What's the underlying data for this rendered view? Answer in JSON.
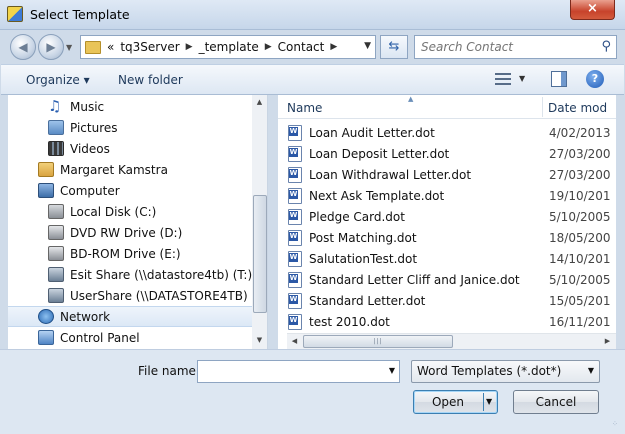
{
  "window": {
    "title": "Select Template",
    "close_label": "×"
  },
  "nav": {
    "back_glyph": "◀",
    "forward_glyph": "▶",
    "refresh_glyph": "⇆"
  },
  "address": {
    "overflow": "«",
    "segments": [
      "tq3Server",
      "_template",
      "Contact"
    ]
  },
  "search": {
    "placeholder": "Search Contact"
  },
  "toolbar": {
    "organize_label": "Organize ▾",
    "new_folder_label": "New folder",
    "help_label": "?"
  },
  "sidebar": {
    "items": [
      {
        "label": "Music",
        "icon": "music-icon",
        "color": "#2a5fb0"
      },
      {
        "label": "Pictures",
        "icon": "pictures-icon",
        "color": "#5a8bc4"
      },
      {
        "label": "Videos",
        "icon": "videos-icon",
        "color": "#3a3a3a"
      },
      {
        "label": "Margaret Kamstra",
        "icon": "user-folder-icon",
        "color": "#d9a441"
      },
      {
        "label": "Computer",
        "icon": "computer-icon",
        "color": "#3d6ea8"
      },
      {
        "label": "Local Disk (C:)",
        "icon": "local-disk-icon",
        "color": "#8a8f96"
      },
      {
        "label": "DVD RW Drive (D:)",
        "icon": "dvd-drive-icon",
        "color": "#8a8f96"
      },
      {
        "label": "BD-ROM Drive (E:)",
        "icon": "bd-drive-icon",
        "color": "#8a8f96"
      },
      {
        "label": "Esit Share (\\\\datastore4tb) (T:)",
        "icon": "network-drive-icon",
        "color": "#6b7f95"
      },
      {
        "label": "UserShare (\\\\DATASTORE4TB) (U:)",
        "icon": "network-drive-icon",
        "color": "#6b7f95"
      },
      {
        "label": "Network",
        "icon": "network-icon",
        "color": "#2e6cb5",
        "selected": true
      },
      {
        "label": "Control Panel",
        "icon": "control-panel-icon",
        "color": "#4f84c4"
      }
    ]
  },
  "files": {
    "columns": {
      "name": "Name",
      "date": "Date mod"
    },
    "rows": [
      {
        "name": "Loan Audit Letter.dot",
        "date": "4/02/2013"
      },
      {
        "name": "Loan Deposit Letter.dot",
        "date": "27/03/200"
      },
      {
        "name": "Loan Withdrawal Letter.dot",
        "date": "27/03/200"
      },
      {
        "name": "Next Ask Template.dot",
        "date": "19/10/201"
      },
      {
        "name": "Pledge Card.dot",
        "date": "5/10/2005"
      },
      {
        "name": "Post Matching.dot",
        "date": "18/05/200"
      },
      {
        "name": "SalutationTest.dot",
        "date": "14/10/201"
      },
      {
        "name": "Standard Letter Cliff and Janice.dot",
        "date": "5/10/2005"
      },
      {
        "name": "Standard Letter.dot",
        "date": "15/05/201"
      },
      {
        "name": "test 2010.dot",
        "date": "16/11/201"
      }
    ]
  },
  "bottom": {
    "filename_label": "File name:",
    "filename_value": "",
    "filter_value": "Word Templates (*.dot*)",
    "open_label": "Open",
    "cancel_label": "Cancel"
  }
}
